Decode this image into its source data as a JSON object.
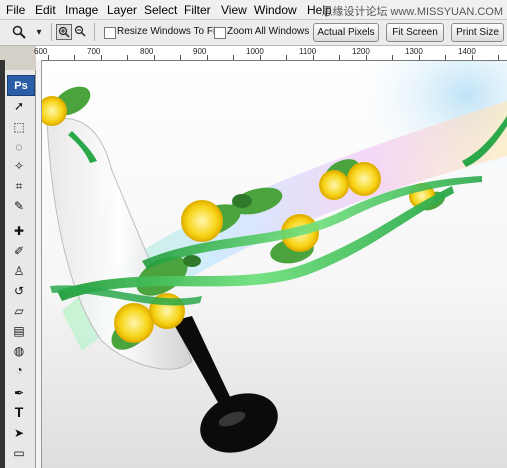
{
  "menu": {
    "items": [
      "File",
      "Edit",
      "Image",
      "Layer",
      "Select",
      "Filter",
      "View",
      "Window",
      "Help"
    ],
    "watermark": "思缘设计论坛 www.MISSYUAN.COM"
  },
  "options": {
    "resize_windows_label": "Resize Windows To Fit",
    "zoom_all_label": "Zoom All Windows",
    "actual_pixels_label": "Actual Pixels",
    "fit_screen_label": "Fit Screen",
    "print_size_label": "Print Size",
    "dropdown_arrow": "▾"
  },
  "ruler": {
    "labels": [
      "600",
      "700",
      "800",
      "900",
      "1000",
      "1100",
      "1200",
      "1300",
      "1400"
    ]
  },
  "toolbox": {
    "logo": "Ps",
    "tools": [
      {
        "icon": "move-icon",
        "glyph": "➚"
      },
      {
        "icon": "marquee-icon",
        "glyph": "⬚"
      },
      {
        "icon": "lasso-icon",
        "glyph": "◌"
      },
      {
        "icon": "magic-wand-icon",
        "glyph": "✧"
      },
      {
        "icon": "crop-icon",
        "glyph": "⌗"
      },
      {
        "icon": "eyedropper-icon",
        "glyph": "✎"
      },
      {
        "icon": "healing-brush-icon",
        "glyph": "✚"
      },
      {
        "icon": "brush-icon",
        "glyph": "✐"
      },
      {
        "icon": "clone-stamp-icon",
        "glyph": "♙"
      },
      {
        "icon": "history-brush-icon",
        "glyph": "↺"
      },
      {
        "icon": "eraser-icon",
        "glyph": "▱"
      },
      {
        "icon": "gradient-icon",
        "glyph": "▤"
      },
      {
        "icon": "blur-icon",
        "glyph": "◍"
      },
      {
        "icon": "dodge-icon",
        "glyph": "◔"
      },
      {
        "icon": "pen-icon",
        "glyph": "✒"
      },
      {
        "icon": "type-icon",
        "glyph": "T"
      },
      {
        "icon": "path-selection-icon",
        "glyph": "➤"
      },
      {
        "icon": "shape-icon",
        "glyph": "▭"
      }
    ]
  },
  "colors": {
    "ps_blue": "#2a5fa8",
    "ribbon_green": "#35c14a",
    "lemon_yellow": "#f5d21a",
    "glass_black": "#0b0b0b"
  }
}
